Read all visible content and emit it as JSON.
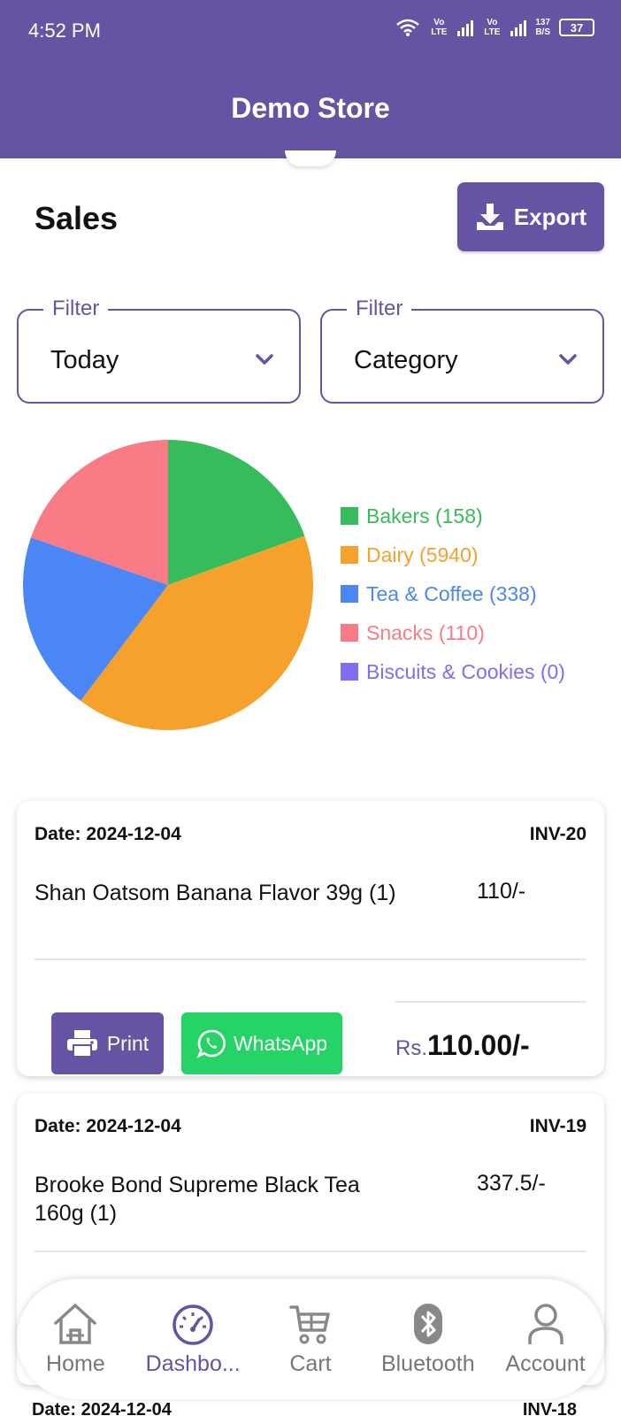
{
  "status_bar": {
    "time": "4:52 PM",
    "net_speed_top": "137",
    "net_speed_bottom": "B/S",
    "battery": "37",
    "sim1": "Vo LTE",
    "sim2": "Vo LTE"
  },
  "app_bar": {
    "title": "Demo Store"
  },
  "header": {
    "title": "Sales",
    "export_label": "Export"
  },
  "filters": [
    {
      "legend": "Filter",
      "value": "Today"
    },
    {
      "legend": "Filter",
      "value": "Category"
    }
  ],
  "chart_data": {
    "type": "pie",
    "categories": [
      "Bakers",
      "Dairy",
      "Tea & Coffee",
      "Snacks",
      "Biscuits & Cookies"
    ],
    "values": [
      158,
      5940,
      338,
      110,
      0
    ],
    "legend_labels": [
      "Bakers (158)",
      "Dairy (5940)",
      "Tea & Coffee (338)",
      "Snacks (110)",
      "Biscuits & Cookies (0)"
    ],
    "slice_fractions_shown": [
      0.195,
      0.408,
      0.2,
      0.197,
      0.0
    ],
    "colors": [
      "#37bc5c",
      "#f6a12b",
      "#4a86f6",
      "#f87b86",
      "#7e6ef3"
    ],
    "legend_position": "right"
  },
  "invoices": [
    {
      "date": "Date: 2024-12-04",
      "invoice": "INV-20",
      "item": "Shan Oatsom Banana Flavor 39g (1)",
      "price": "110/-",
      "print_label": "Print",
      "whatsapp_label": "WhatsApp",
      "currency": "Rs.",
      "total": "110.00/-"
    },
    {
      "date": "Date: 2024-12-04",
      "invoice": "INV-19",
      "item": "Brooke Bond Supreme Black Tea 160g (1)",
      "price": "337.5/-"
    },
    {
      "date": "Date: 2024-12-04",
      "invoice": "INV-18"
    }
  ],
  "bottom_nav": [
    {
      "label": "Home",
      "icon": "home-icon"
    },
    {
      "label": "Dashbo...",
      "icon": "dashboard-gauge-icon",
      "active": true
    },
    {
      "label": "Cart",
      "icon": "cart-icon"
    },
    {
      "label": "Bluetooth",
      "icon": "bluetooth-icon"
    },
    {
      "label": "Account",
      "icon": "account-icon"
    }
  ],
  "colors": {
    "primary": "#6753a4",
    "whatsapp": "#25d366"
  }
}
